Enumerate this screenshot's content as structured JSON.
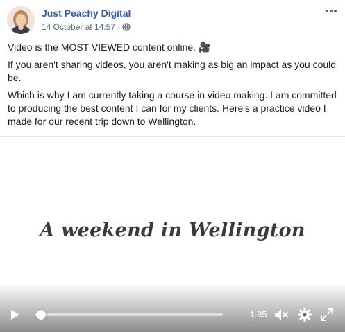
{
  "post": {
    "page_name": "Just Peachy Digital",
    "timestamp": "14 October at 14:57",
    "separator": "·",
    "privacy_icon": "globe-icon",
    "more_icon": "more-options-icon",
    "paragraphs": [
      "Video is the MOST VIEWED content online. 🎥",
      "If you aren't sharing videos, you aren't making as big an impact as you could be.",
      "Which is why I am currently taking a course in video making. I am committed to producing the best content I can for my clients. Here's a practice video I made for our recent trip down to Wellington."
    ]
  },
  "video": {
    "title_card": "A weekend in Wellington",
    "progress": 0.02,
    "time_remaining": "-1:35",
    "icons": [
      "play-icon",
      "volume-muted-icon",
      "settings-gear-icon",
      "fullscreen-icon"
    ]
  },
  "colors": {
    "page_name": "#385898",
    "meta_text": "#606770",
    "body_text": "#1c1e21"
  }
}
